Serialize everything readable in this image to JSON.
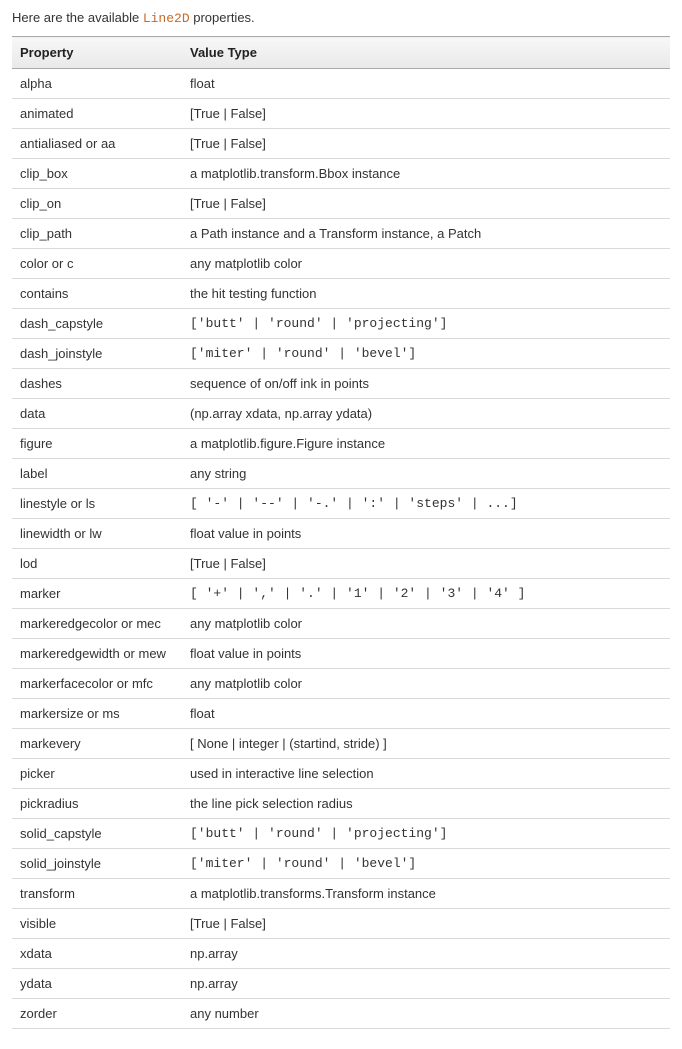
{
  "intro": {
    "prefix": "Here are the available ",
    "class_name": "Line2D",
    "suffix": " properties."
  },
  "table": {
    "headers": {
      "property": "Property",
      "value_type": "Value Type"
    },
    "rows": [
      {
        "property": "alpha",
        "value": "float",
        "mono": false
      },
      {
        "property": "animated",
        "value": "[True | False]",
        "mono": false
      },
      {
        "property": "antialiased or aa",
        "value": "[True | False]",
        "mono": false
      },
      {
        "property": "clip_box",
        "value": "a matplotlib.transform.Bbox instance",
        "mono": false
      },
      {
        "property": "clip_on",
        "value": "[True | False]",
        "mono": false
      },
      {
        "property": "clip_path",
        "value": "a Path instance and a Transform instance, a Patch",
        "mono": false
      },
      {
        "property": "color or c",
        "value": "any matplotlib color",
        "mono": false
      },
      {
        "property": "contains",
        "value": "the hit testing function",
        "mono": false
      },
      {
        "property": "dash_capstyle",
        "value": "['butt' | 'round' | 'projecting']",
        "mono": true
      },
      {
        "property": "dash_joinstyle",
        "value": "['miter' | 'round' | 'bevel']",
        "mono": true
      },
      {
        "property": "dashes",
        "value": "sequence of on/off ink in points",
        "mono": false
      },
      {
        "property": "data",
        "value": "(np.array xdata, np.array ydata)",
        "mono": false
      },
      {
        "property": "figure",
        "value": "a matplotlib.figure.Figure instance",
        "mono": false
      },
      {
        "property": "label",
        "value": "any string",
        "mono": false
      },
      {
        "property": "linestyle or ls",
        "value": "[ '-' | '--' | '-.' | ':' | 'steps' | ...]",
        "mono": true
      },
      {
        "property": "linewidth or lw",
        "value": "float value in points",
        "mono": false
      },
      {
        "property": "lod",
        "value": "[True | False]",
        "mono": false
      },
      {
        "property": "marker",
        "value": "[ '+' | ',' | '.' | '1' | '2' | '3' | '4' ]",
        "mono": true
      },
      {
        "property": "markeredgecolor or mec",
        "value": "any matplotlib color",
        "mono": false
      },
      {
        "property": "markeredgewidth or mew",
        "value": "float value in points",
        "mono": false
      },
      {
        "property": "markerfacecolor or mfc",
        "value": "any matplotlib color",
        "mono": false
      },
      {
        "property": "markersize or ms",
        "value": "float",
        "mono": false
      },
      {
        "property": "markevery",
        "value": "[ None | integer | (startind, stride) ]",
        "mono": false
      },
      {
        "property": "picker",
        "value": "used in interactive line selection",
        "mono": false
      },
      {
        "property": "pickradius",
        "value": "the line pick selection radius",
        "mono": false
      },
      {
        "property": "solid_capstyle",
        "value": "['butt' | 'round' | 'projecting']",
        "mono": true
      },
      {
        "property": "solid_joinstyle",
        "value": "['miter' | 'round' | 'bevel']",
        "mono": true
      },
      {
        "property": "transform",
        "value": "a matplotlib.transforms.Transform instance",
        "mono": false
      },
      {
        "property": "visible",
        "value": "[True | False]",
        "mono": false
      },
      {
        "property": "xdata",
        "value": "np.array",
        "mono": false
      },
      {
        "property": "ydata",
        "value": "np.array",
        "mono": false
      },
      {
        "property": "zorder",
        "value": "any number",
        "mono": false
      }
    ]
  }
}
